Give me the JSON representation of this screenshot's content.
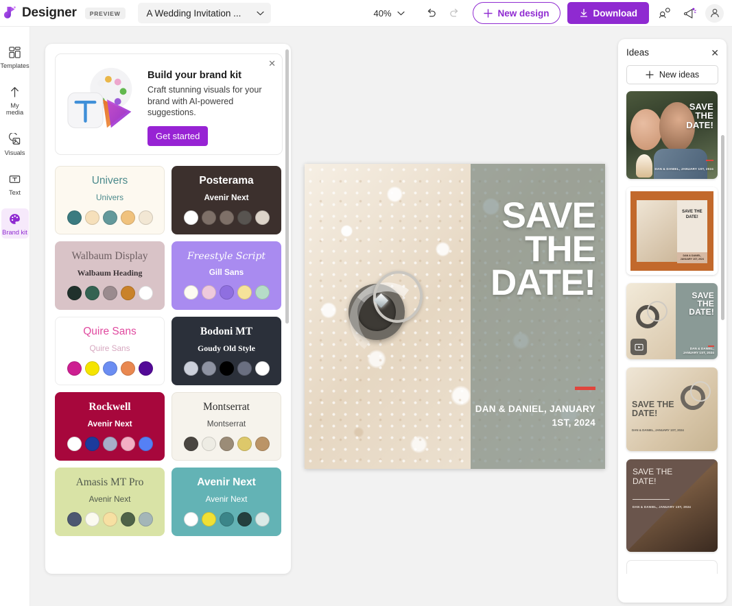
{
  "header": {
    "logo_icon": "designer-logo-icon",
    "app_title": "Designer",
    "preview_badge": "PREVIEW",
    "document_name": "A Wedding Invitation ...",
    "document_chevron_icon": "chevron-down-icon",
    "zoom_value": "40%",
    "zoom_chevron_icon": "chevron-down-icon",
    "undo_icon": "undo-icon",
    "redo_icon": "redo-icon",
    "new_design_label": "New design",
    "new_design_icon": "plus-icon",
    "download_label": "Download",
    "download_icon": "download-arrow-icon",
    "collab_icon": "collaborate-icon",
    "feedback_icon": "megaphone-icon",
    "account_icon": "person-icon",
    "accent_color": "#8f2ad1"
  },
  "rail": {
    "items": [
      {
        "label": "Templates",
        "icon": "templates-grid-icon",
        "active": false
      },
      {
        "label": "My media",
        "icon": "upload-arrow-icon",
        "active": false
      },
      {
        "label": "Visuals",
        "icon": "image-icon",
        "active": false
      },
      {
        "label": "Text",
        "icon": "text-box-icon",
        "active": false
      },
      {
        "label": "Brand kit",
        "icon": "palette-icon",
        "active": true
      }
    ]
  },
  "promo": {
    "title": "Build your brand kit",
    "description": "Craft stunning visuals for your brand with AI-powered suggestions.",
    "button_label": "Get started",
    "close_icon": "close-icon",
    "art_icon": "brand-kit-art-icon"
  },
  "brand_cards": [
    {
      "heading": "Univers",
      "subheading": "Univers",
      "bg": "#fdf9f0",
      "heading_color": "#4b8a8c",
      "sub_color": "#4b8a8c",
      "border": "#ebe6da",
      "swatches": [
        "#3b7b80",
        "#f6e0bb",
        "#63999b",
        "#f0c27d",
        "#f2e7d4"
      ]
    },
    {
      "heading": "Posterama",
      "subheading": "Avenir Next",
      "bg": "#3c302d",
      "heading_color": "#ffffff",
      "sub_color": "#ffffff",
      "border": "#3c302d",
      "swatches": [
        "#ffffff",
        "#b07category",
        "#7e7068",
        "#585450",
        "#ddd4c9"
      ]
    },
    {
      "heading": "Walbaum Display",
      "subheading": "Walbaum Heading",
      "bg": "#d9c3c7",
      "heading_color": "#6d5f62",
      "sub_color": "#3b3336",
      "border": "#d9c3c7",
      "swatches": [
        "#20312c",
        "#336352",
        "#9a8b8e",
        "#c9822a",
        "#ffffff"
      ]
    },
    {
      "heading": "Freestyle Script",
      "subheading": "Gill Sans",
      "bg": "#a98bf0",
      "heading_color": "#ffffff",
      "sub_color": "#ffffff",
      "border": "#a98bf0",
      "swatches": [
        "#fdfbf2",
        "#eec9dc",
        "#8f6fe0",
        "#f6e39a",
        "#b6dcc8"
      ]
    },
    {
      "heading": "Quire Sans",
      "subheading": "Quire Sans",
      "bg": "#ffffff",
      "heading_color": "#e0499f",
      "sub_color": "#d6a7bf",
      "border": "#ececec",
      "swatches": [
        "#cd1f91",
        "#f5e400",
        "#6b8df2",
        "#e98850",
        "#530a97"
      ]
    },
    {
      "heading": "Bodoni MT",
      "subheading": "Goudy Old Style",
      "bg": "#2b303a",
      "heading_color": "#ffffff",
      "sub_color": "#ffffff",
      "border": "#2b303a",
      "swatches": [
        "#ccd0db",
        "#8e93a2",
        "#000000",
        "#6a6f81",
        "#ffffff"
      ]
    },
    {
      "heading": "Rockwell",
      "subheading": "Avenir Next",
      "bg": "#a7073c",
      "heading_color": "#ffffff",
      "sub_color": "#ffffff",
      "border": "#a7073c",
      "swatches": [
        "#ffffff",
        "#1c3b9c",
        "#a7aec9",
        "#f4aec4",
        "#5580f5"
      ]
    },
    {
      "heading": "Montserrat",
      "subheading": "Montserrat",
      "bg": "#f6f3ec",
      "heading_color": "#2c2c2c",
      "sub_color": "#4a4a4a",
      "border": "#e8e4da",
      "swatches": [
        "#4a4641",
        "#eeece4",
        "#9b8c77",
        "#ddc86a",
        "#bb9467"
      ]
    },
    {
      "heading": "Amasis MT Pro",
      "subheading": "Avenir Next",
      "bg": "#d9e3a6",
      "heading_color": "#50594d",
      "sub_color": "#50594d",
      "border": "#d9e3a6",
      "swatches": [
        "#4d5871",
        "#fbfaf0",
        "#f7e0a2",
        "#4f6348",
        "#a4b6b8"
      ]
    },
    {
      "heading": "Avenir Next",
      "subheading": "Avenir Next",
      "bg": "#63b3b5",
      "heading_color": "#ffffff",
      "sub_color": "#ffffff",
      "border": "#63b3b5",
      "swatches": [
        "#ffffff",
        "#f0e035",
        "#3b8589",
        "#24403e",
        "#dbeae7"
      ]
    }
  ],
  "canvas": {
    "design_title_line1": "SAVE",
    "design_title_line2": "THE",
    "design_title_line3": "DATE!",
    "design_subtitle": "DAN & DANIEL, JANUARY 1ST, 2024",
    "accent_color": "#e0453c",
    "photo_alt": "wedding-rings-on-lace-photo"
  },
  "ideas": {
    "title": "Ideas",
    "close_icon": "close-icon",
    "new_ideas_label": "New ideas",
    "new_ideas_icon": "plus-icon",
    "cards": [
      {
        "name": "idea-card-couple-icecream",
        "title": "SAVE THE DATE!",
        "subtitle": "DAN & DANIEL, JANUARY 1ST, 2024",
        "has_video_badge": false
      },
      {
        "name": "idea-card-orange-frame",
        "title": "SAVE THE DATE!",
        "subtitle": "DAN & DANIEL, JANUARY 1ST, 2024",
        "has_video_badge": false
      },
      {
        "name": "idea-card-rings-split",
        "title": "SAVE THE DATE!",
        "subtitle": "DAN & DANIEL, JANUARY 1ST, 2024",
        "has_video_badge": true
      },
      {
        "name": "idea-card-lace-light",
        "title": "SAVE THE DATE!",
        "subtitle": "DAN & DANIEL, JANUARY 1ST, 2024",
        "has_video_badge": false
      },
      {
        "name": "idea-card-diagonal-brown",
        "title": "SAVE THE DATE!",
        "subtitle": "DAN & DANIEL, JANUARY 1ST, 2024",
        "has_video_badge": false
      }
    ]
  }
}
